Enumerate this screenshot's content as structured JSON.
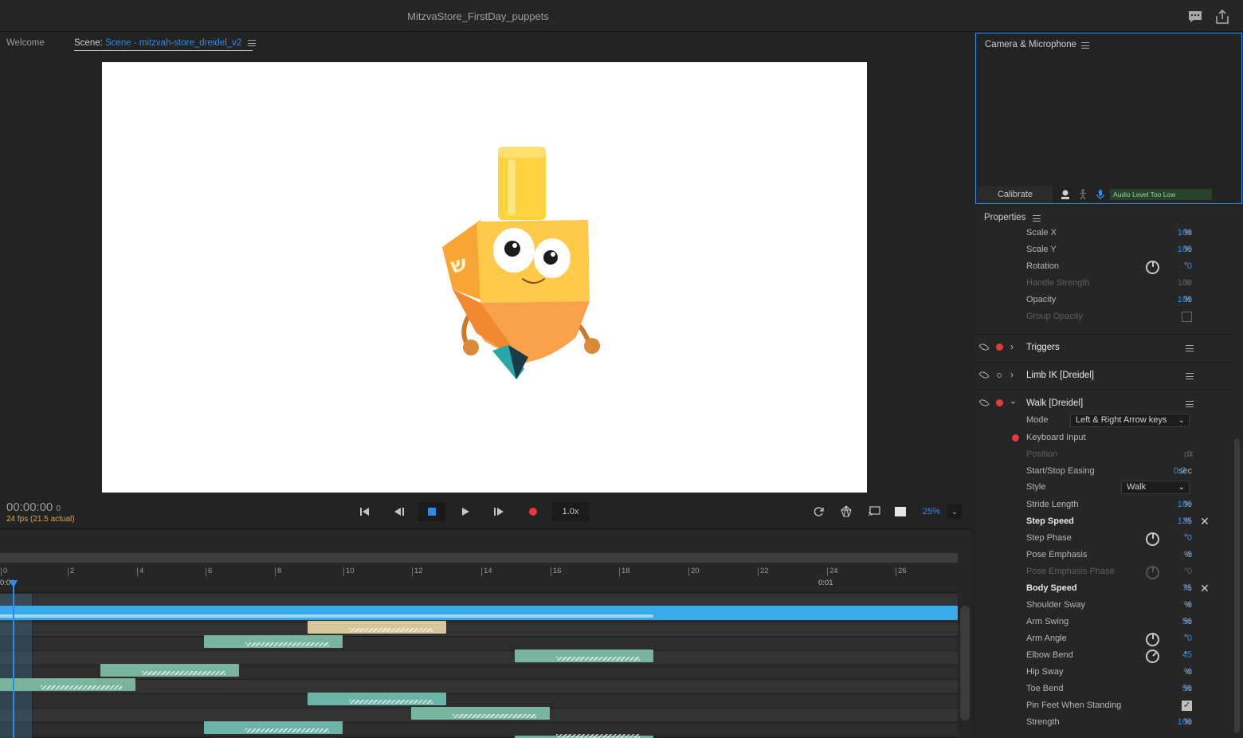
{
  "window": {
    "title": "MitzvaStore_FirstDay_puppets"
  },
  "tabs": {
    "welcome": "Welcome",
    "scene_prefix": "Scene:",
    "scene_name": "Scene - mitzvah-store_dreidel_v2"
  },
  "transport": {
    "timecode": "00:00:00",
    "frame": "0",
    "fps": "24 fps (21.5 actual)",
    "speed": "1.0x",
    "zoom": "25%"
  },
  "timeline": {
    "ticks": [
      "0",
      "2",
      "4",
      "6",
      "8",
      "10",
      "12",
      "14",
      "16",
      "18",
      "20",
      "22",
      "24",
      "26"
    ],
    "seconds_label": "0:01",
    "start_label": "0:00"
  },
  "camera_panel": {
    "title": "Camera & Microphone",
    "calibrate": "Calibrate",
    "audio_status": "Audio Level Too Low"
  },
  "properties": {
    "title": "Properties",
    "transform": [
      {
        "label": "Scale X",
        "value": "100",
        "unit": "%"
      },
      {
        "label": "Scale Y",
        "value": "100",
        "unit": "%"
      },
      {
        "label": "Rotation",
        "value": "0",
        "unit": "°"
      },
      {
        "label": "Handle Strength",
        "value": "100",
        "unit": "%"
      },
      {
        "label": "Opacity",
        "value": "100",
        "unit": "%"
      },
      {
        "label": "Group Opacity"
      }
    ],
    "sections": {
      "triggers": "Triggers",
      "limb_ik": "Limb IK [Dreidel]",
      "walk": "Walk [Dreidel]"
    },
    "walk": {
      "mode_label": "Mode",
      "mode_value": "Left & Right Arrow keys",
      "keyboard_input": "Keyboard Input",
      "position": {
        "label": "Position",
        "value": "0",
        "unit": "px"
      },
      "easing": {
        "label": "Start/Stop Easing",
        "value": "0.2",
        "unit": "sec"
      },
      "style_label": "Style",
      "style_value": "Walk",
      "params": [
        {
          "label": "Stride Length",
          "value": "100",
          "unit": "%"
        },
        {
          "label": "Step Speed",
          "value": "125",
          "unit": "%"
        },
        {
          "label": "Step Phase",
          "value": "0",
          "unit": "°"
        },
        {
          "label": "Pose Emphasis",
          "value": "0",
          "unit": "%"
        },
        {
          "label": "Pose Emphasis Phase",
          "value": "0",
          "unit": "°"
        },
        {
          "label": "Body Speed",
          "value": "75",
          "unit": "%"
        },
        {
          "label": "Shoulder Sway",
          "value": "0",
          "unit": "%"
        },
        {
          "label": "Arm Swing",
          "value": "50",
          "unit": "%"
        },
        {
          "label": "Arm Angle",
          "value": "0",
          "unit": "°"
        },
        {
          "label": "Elbow Bend",
          "value": "45",
          "unit": "°"
        },
        {
          "label": "Hip Sway",
          "value": "0",
          "unit": "%"
        },
        {
          "label": "Toe Bend",
          "value": "50",
          "unit": "%"
        },
        {
          "label": "Pin Feet When Standing"
        },
        {
          "label": "Strength",
          "value": "100",
          "unit": "%"
        }
      ]
    }
  },
  "colors": {
    "accent": "#2d8ceb",
    "record": "#e33b3b",
    "fps_warning": "#e4a640"
  }
}
